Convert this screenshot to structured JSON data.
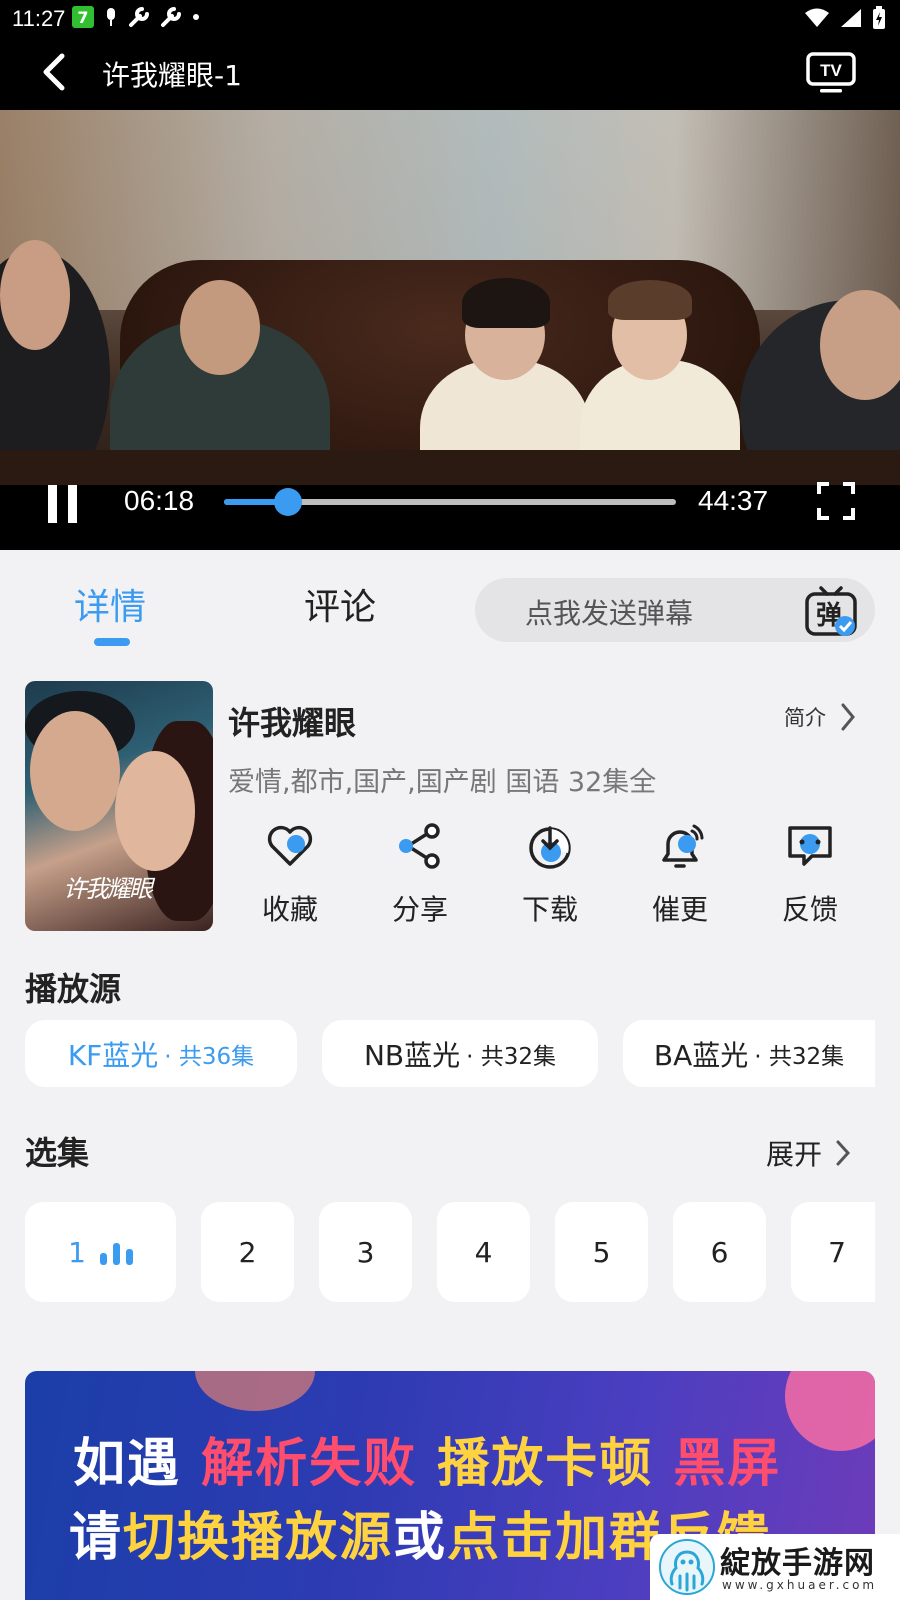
{
  "status_bar": {
    "time": "11:27",
    "app_badge": "7",
    "icons": [
      "app-7-icon",
      "silent-icon",
      "wrench-icon",
      "wrench-icon",
      "dot-icon",
      "wifi-icon",
      "signal-icon",
      "battery-icon"
    ]
  },
  "header": {
    "title": "许我耀眼-1",
    "tv_icon_label": "TV"
  },
  "player": {
    "current_time": "06:18",
    "duration": "44:37",
    "progress": 0.141,
    "state": "playing"
  },
  "tabs": {
    "details": "详情",
    "comments": "评论",
    "active": "details"
  },
  "danmu": {
    "placeholder": "点我发送弹幕",
    "icon_label": "弹"
  },
  "show": {
    "title": "许我耀眼",
    "intro_label": "简介",
    "meta": "爱情,都市,国产,国产剧 国语 32集全",
    "poster_title": "许我耀眼"
  },
  "actions": [
    {
      "label": "收藏",
      "icon": "heart-icon"
    },
    {
      "label": "分享",
      "icon": "share-icon"
    },
    {
      "label": "下载",
      "icon": "download-icon"
    },
    {
      "label": "催更",
      "icon": "bell-icon"
    },
    {
      "label": "反馈",
      "icon": "feedback-icon"
    }
  ],
  "sources": {
    "title": "播放源",
    "items": [
      {
        "name": "KF蓝光",
        "count": "· 共36集",
        "active": true
      },
      {
        "name": "NB蓝光",
        "count": "· 共32集",
        "active": false
      },
      {
        "name": "BA蓝光",
        "count": "· 共32集",
        "active": false
      }
    ]
  },
  "episodes": {
    "title": "选集",
    "expand_label": "展开",
    "items": [
      "1",
      "2",
      "3",
      "4",
      "5",
      "6",
      "7"
    ],
    "active": "1"
  },
  "banner": {
    "line1": [
      "如遇",
      "解析失败",
      "播放卡顿",
      "黑屏"
    ],
    "line2": [
      "请",
      "切换播放源",
      "或",
      "点击加群反馈"
    ]
  },
  "watermark": {
    "text": "綻放手游网",
    "url": "www.gxhuaer.com"
  },
  "colors": {
    "accent": "#3a9bf0",
    "banner_red": "#ff4d6d",
    "banner_yellow": "#ffd23f"
  }
}
